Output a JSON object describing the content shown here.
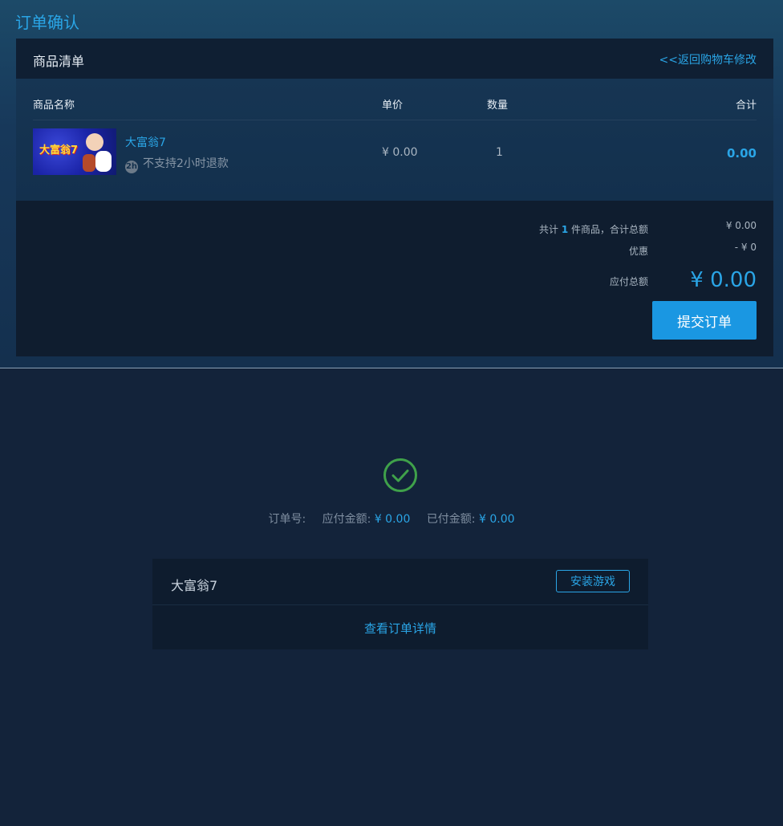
{
  "page": {
    "title": "订单确认"
  },
  "cart": {
    "header": "商品清单",
    "back_link": "<<返回购物车修改"
  },
  "columns": {
    "name": "商品名称",
    "price": "单价",
    "qty": "数量",
    "total": "合计"
  },
  "product": {
    "name": "大富翁7",
    "refund_icon": "2h-refund-icon",
    "refund_text": "不支持2小时退款",
    "thumb_text": "大富翁7",
    "price": "¥ 0.00",
    "qty": "1",
    "total": "0.00"
  },
  "summary": {
    "count_prefix": "共计 ",
    "count": "1",
    "count_suffix": " 件商品，合计总额",
    "subtotal": "¥ 0.00",
    "discount_label": "优惠",
    "discount_value": "- ¥ 0",
    "payable_label": "应付总额",
    "payable_value": "¥ 0.00",
    "submit": "提交订单"
  },
  "result": {
    "status_icon": "check-circle-icon",
    "order_no_label": "订单号:",
    "payable_label": "应付金额:",
    "payable_value": "¥ 0.00",
    "paid_label": "已付金额:",
    "paid_value": "¥ 0.00",
    "game_name": "大富翁7",
    "install": "安装游戏",
    "detail_link": "查看订单详情"
  },
  "colors": {
    "accent": "#2aa5e6",
    "success": "#3fa14a",
    "submit_bg": "#1a97e2"
  }
}
